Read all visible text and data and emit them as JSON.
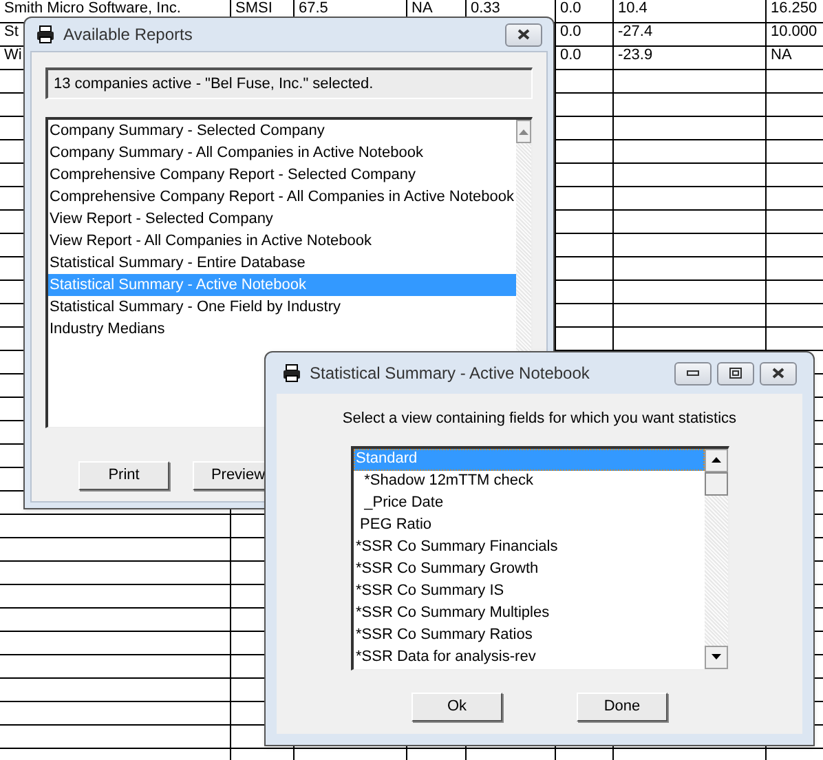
{
  "sheet": {
    "rows": [
      {
        "column_1": "Smith Micro Software, Inc.",
        "column_2": "SMSI",
        "column_3": "67.5",
        "column_4": "NA",
        "column_5": "0.33",
        "column_6": "0.0",
        "column_7": "10.4",
        "column_8": "16.250"
      },
      {
        "column_1": "St",
        "column_6": "0.0",
        "column_7": "-27.4",
        "column_8": "10.000"
      },
      {
        "column_1": "Wi",
        "column_6": "0.0",
        "column_7": "-23.9",
        "column_8": "NA"
      }
    ]
  },
  "reports_window": {
    "title": "Available Reports",
    "status": "13 companies active - \"Bel Fuse, Inc.\" selected.",
    "items": [
      {
        "label": "Company Summary - Selected Company",
        "selected": false
      },
      {
        "label": "Company Summary - All Companies in Active Notebook",
        "selected": false
      },
      {
        "label": "Comprehensive Company Report - Selected Company",
        "selected": false
      },
      {
        "label": "Comprehensive Company Report - All Companies in Active Notebook",
        "selected": false
      },
      {
        "label": "View Report - Selected Company",
        "selected": false
      },
      {
        "label": "View Report - All Companies in Active Notebook",
        "selected": false
      },
      {
        "label": "Statistical Summary - Entire Database",
        "selected": false
      },
      {
        "label": "Statistical Summary - Active Notebook",
        "selected": true
      },
      {
        "label": "Statistical Summary - One Field by Industry",
        "selected": false
      },
      {
        "label": "Industry Medians",
        "selected": false
      }
    ],
    "buttons": [
      "Print",
      "Preview"
    ]
  },
  "stats_window": {
    "title": "Statistical Summary - Active Notebook",
    "prompt": "Select a view containing fields for which you want statistics",
    "items": [
      {
        "label": "Standard",
        "selected": true
      },
      {
        "label": "  *Shadow 12mTTM check",
        "selected": false
      },
      {
        "label": "  _Price Date",
        "selected": false
      },
      {
        "label": " PEG Ratio",
        "selected": false
      },
      {
        "label": "*SSR Co Summary Financials",
        "selected": false
      },
      {
        "label": "*SSR Co Summary Growth",
        "selected": false
      },
      {
        "label": "*SSR Co Summary IS",
        "selected": false
      },
      {
        "label": "*SSR Co Summary Multiples",
        "selected": false
      },
      {
        "label": "*SSR Co Summary Ratios",
        "selected": false
      },
      {
        "label": "*SSR Data for analysis-rev",
        "selected": false
      }
    ],
    "buttons": [
      "Ok",
      "Done"
    ]
  }
}
